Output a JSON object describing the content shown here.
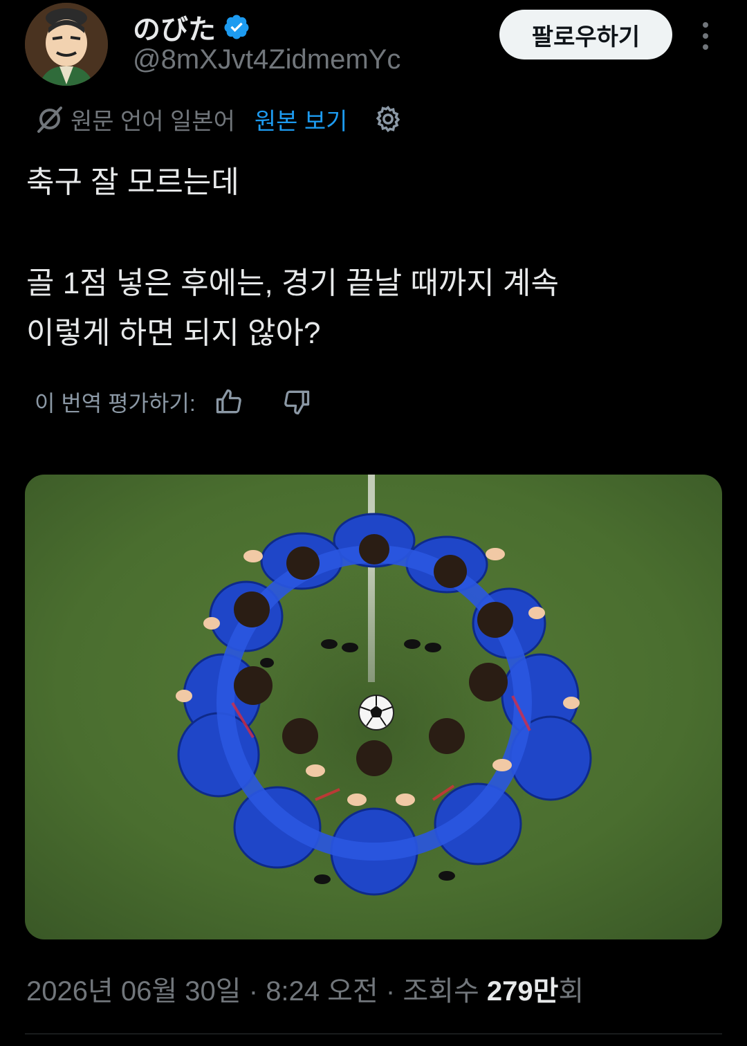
{
  "author": {
    "display_name": "のびた",
    "handle": "@8mXJvt4ZidmemYc",
    "verified": true
  },
  "header": {
    "follow_label": "팔로우하기"
  },
  "translation": {
    "source_label": "원문 언어 일본어",
    "show_original_label": "원본 보기"
  },
  "tweet": {
    "lines": [
      "축구 잘 모르는데",
      "골 1점 넣은 후에는, 경기 끝날 때까지 계속",
      "이렇게 하면 되지 않아?"
    ]
  },
  "rating": {
    "label": "이 번역 평가하기:"
  },
  "meta": {
    "date": "2026년 06월 30일",
    "separator": "·",
    "time": "8:24 오전",
    "views_label": "조회수",
    "views_value": "279만",
    "views_suffix": "회"
  },
  "colors": {
    "background": "#000000",
    "text": "#e7e9ea",
    "muted": "#71767b",
    "link": "#1d9bf0",
    "verified": "#1d9bf0",
    "follow_bg": "#eff3f4"
  }
}
